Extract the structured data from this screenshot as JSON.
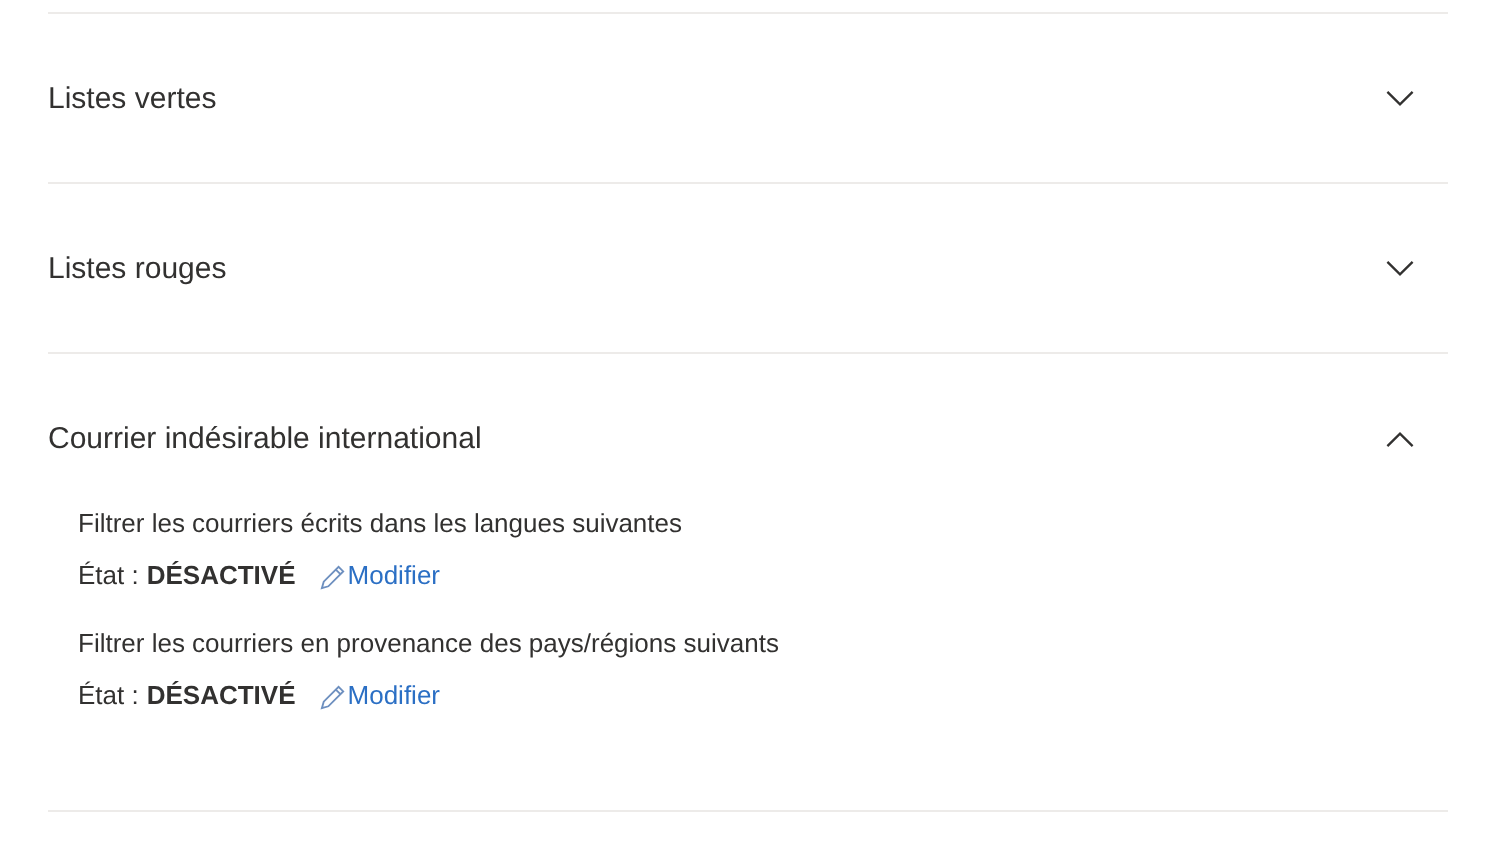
{
  "sections": [
    {
      "title": "Listes vertes",
      "expanded": false
    },
    {
      "title": "Listes rouges",
      "expanded": false
    },
    {
      "title": "Courrier indésirable international",
      "expanded": true,
      "settings": [
        {
          "label": "Filtrer les courriers écrits dans les langues suivantes",
          "state_label": "État :",
          "state": "DÉSACTIVÉ",
          "link": "Modifier"
        },
        {
          "label": "Filtrer les courriers en provenance des pays/régions suivants",
          "state_label": "État :",
          "state": "DÉSACTIVÉ",
          "link": "Modifier"
        }
      ]
    }
  ]
}
